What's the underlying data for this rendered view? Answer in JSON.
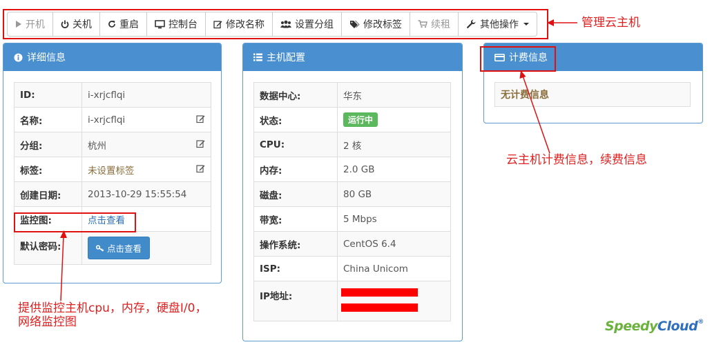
{
  "toolbar": {
    "power_on": "开机",
    "power_off": "关机",
    "restart": "重启",
    "console": "控制台",
    "rename": "修改名称",
    "set_group": "设置分组",
    "edit_tags": "修改标签",
    "renew": "续租",
    "more": "其他操作"
  },
  "details": {
    "title": "详细信息",
    "rows": [
      {
        "label": "ID:",
        "value": "i-xrjcflqi"
      },
      {
        "label": "名称:",
        "value": "i-xrjcflqi"
      },
      {
        "label": "分组:",
        "value": "杭州"
      },
      {
        "label": "标签:",
        "value": "未设置标签"
      },
      {
        "label": "创建日期:",
        "value": "2013-10-29 15:55:54"
      },
      {
        "label": "监控图:",
        "value": "点击查看"
      },
      {
        "label": "默认密码:",
        "value": "点击查看"
      }
    ]
  },
  "config": {
    "title": "主机配置",
    "rows": [
      {
        "label": "数据中心:",
        "value": "华东"
      },
      {
        "label": "状态:",
        "value": "运行中"
      },
      {
        "label": "CPU:",
        "value": "2 核"
      },
      {
        "label": "内存:",
        "value": "2.0 GB"
      },
      {
        "label": "磁盘:",
        "value": "80 GB"
      },
      {
        "label": "带宽:",
        "value": "5 Mbps"
      },
      {
        "label": "操作系统:",
        "value": "CentOS 6.4"
      },
      {
        "label": "ISP:",
        "value": "China Unicom"
      },
      {
        "label": "IP地址:",
        "value": ""
      }
    ]
  },
  "billing": {
    "title": "计费信息",
    "empty_text": "无计费信息"
  },
  "annotations": {
    "manage": "管理云主机",
    "billing_note": "云主机计费信息，续费信息",
    "monitor_note_line1": "提供监控主机cpu，内存，硬盘I/0，",
    "monitor_note_line2": "网络监控图"
  },
  "logo": {
    "part1": "Speedy",
    "part2": "Cloud",
    "reg": "®"
  },
  "colors": {
    "panel_header": "#4a90d1",
    "annotation_red": "#e01010",
    "status_green": "#5cb85c",
    "button_blue": "#428bca"
  }
}
